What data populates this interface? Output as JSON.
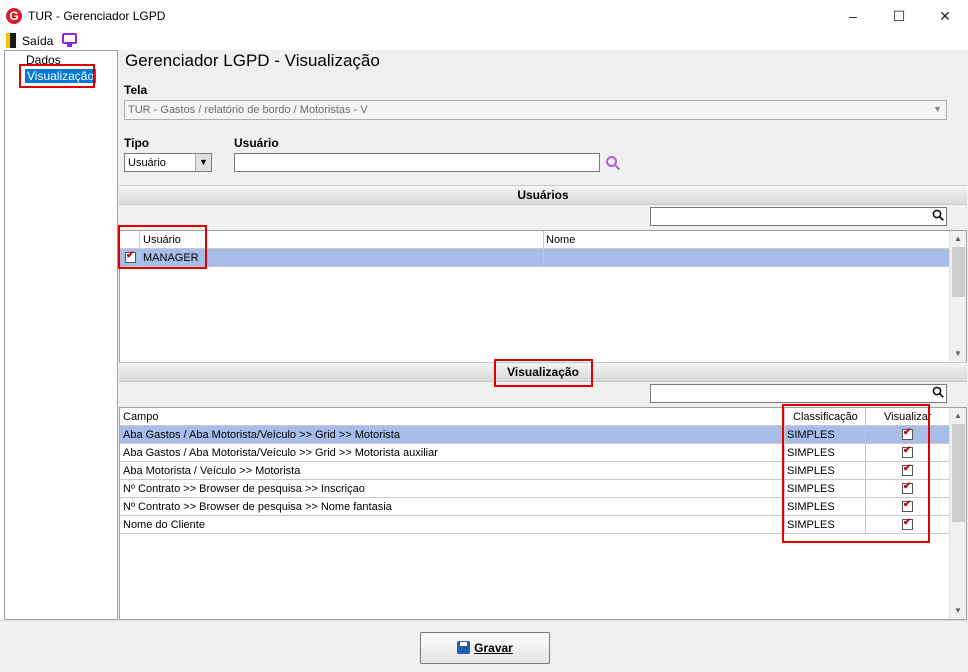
{
  "window": {
    "logo": "G",
    "title": "TUR - Gerenciador LGPD",
    "minimize": "–",
    "maximize": "☐",
    "close": "✕"
  },
  "menu": {
    "exit_label": "Saída"
  },
  "tree": {
    "items": [
      {
        "label": "Dados"
      },
      {
        "label": "Visualização"
      }
    ]
  },
  "page": {
    "title": "Gerenciador LGPD - Visualização"
  },
  "tela": {
    "label": "Tela",
    "value": "TUR - Gastos / relatório de bordo / Motoristas - V"
  },
  "tipo": {
    "label": "Tipo",
    "value": "Usuário"
  },
  "usuario": {
    "label": "Usuário",
    "value": ""
  },
  "users_section": {
    "title": "Usuários",
    "search_value": "",
    "columns": [
      "Usuário",
      "Nome"
    ],
    "rows": [
      {
        "checked": true,
        "usuario": "MANAGER",
        "nome": ""
      }
    ]
  },
  "view_section": {
    "title": "Visualização",
    "search_value": "",
    "columns": [
      "Campo",
      "Classificação",
      "Visualizar"
    ],
    "rows": [
      {
        "campo": "Aba Gastos / Aba  Motorista/Veículo >> Grid >> Motorista",
        "classificacao": "SIMPLES",
        "visualizar": true
      },
      {
        "campo": "Aba Gastos / Aba  Motorista/Veículo >> Grid >> Motorista auxiliar",
        "classificacao": "SIMPLES",
        "visualizar": true
      },
      {
        "campo": "Aba Motorista / Veículo >> Motorista",
        "classificacao": "SIMPLES",
        "visualizar": true
      },
      {
        "campo": "Nº Contrato >> Browser de pesquisa >> Inscriçao",
        "classificacao": "SIMPLES",
        "visualizar": true
      },
      {
        "campo": "Nº Contrato >> Browser de pesquisa >> Nome fantasia",
        "classificacao": "SIMPLES",
        "visualizar": true
      },
      {
        "campo": "Nome do Cliente",
        "classificacao": "SIMPLES",
        "visualizar": true
      }
    ]
  },
  "footer": {
    "save_label": "Gravar"
  },
  "colors": {
    "accent": "#0078d7",
    "selection": "#a7bde8",
    "highlight": "#e00000"
  }
}
